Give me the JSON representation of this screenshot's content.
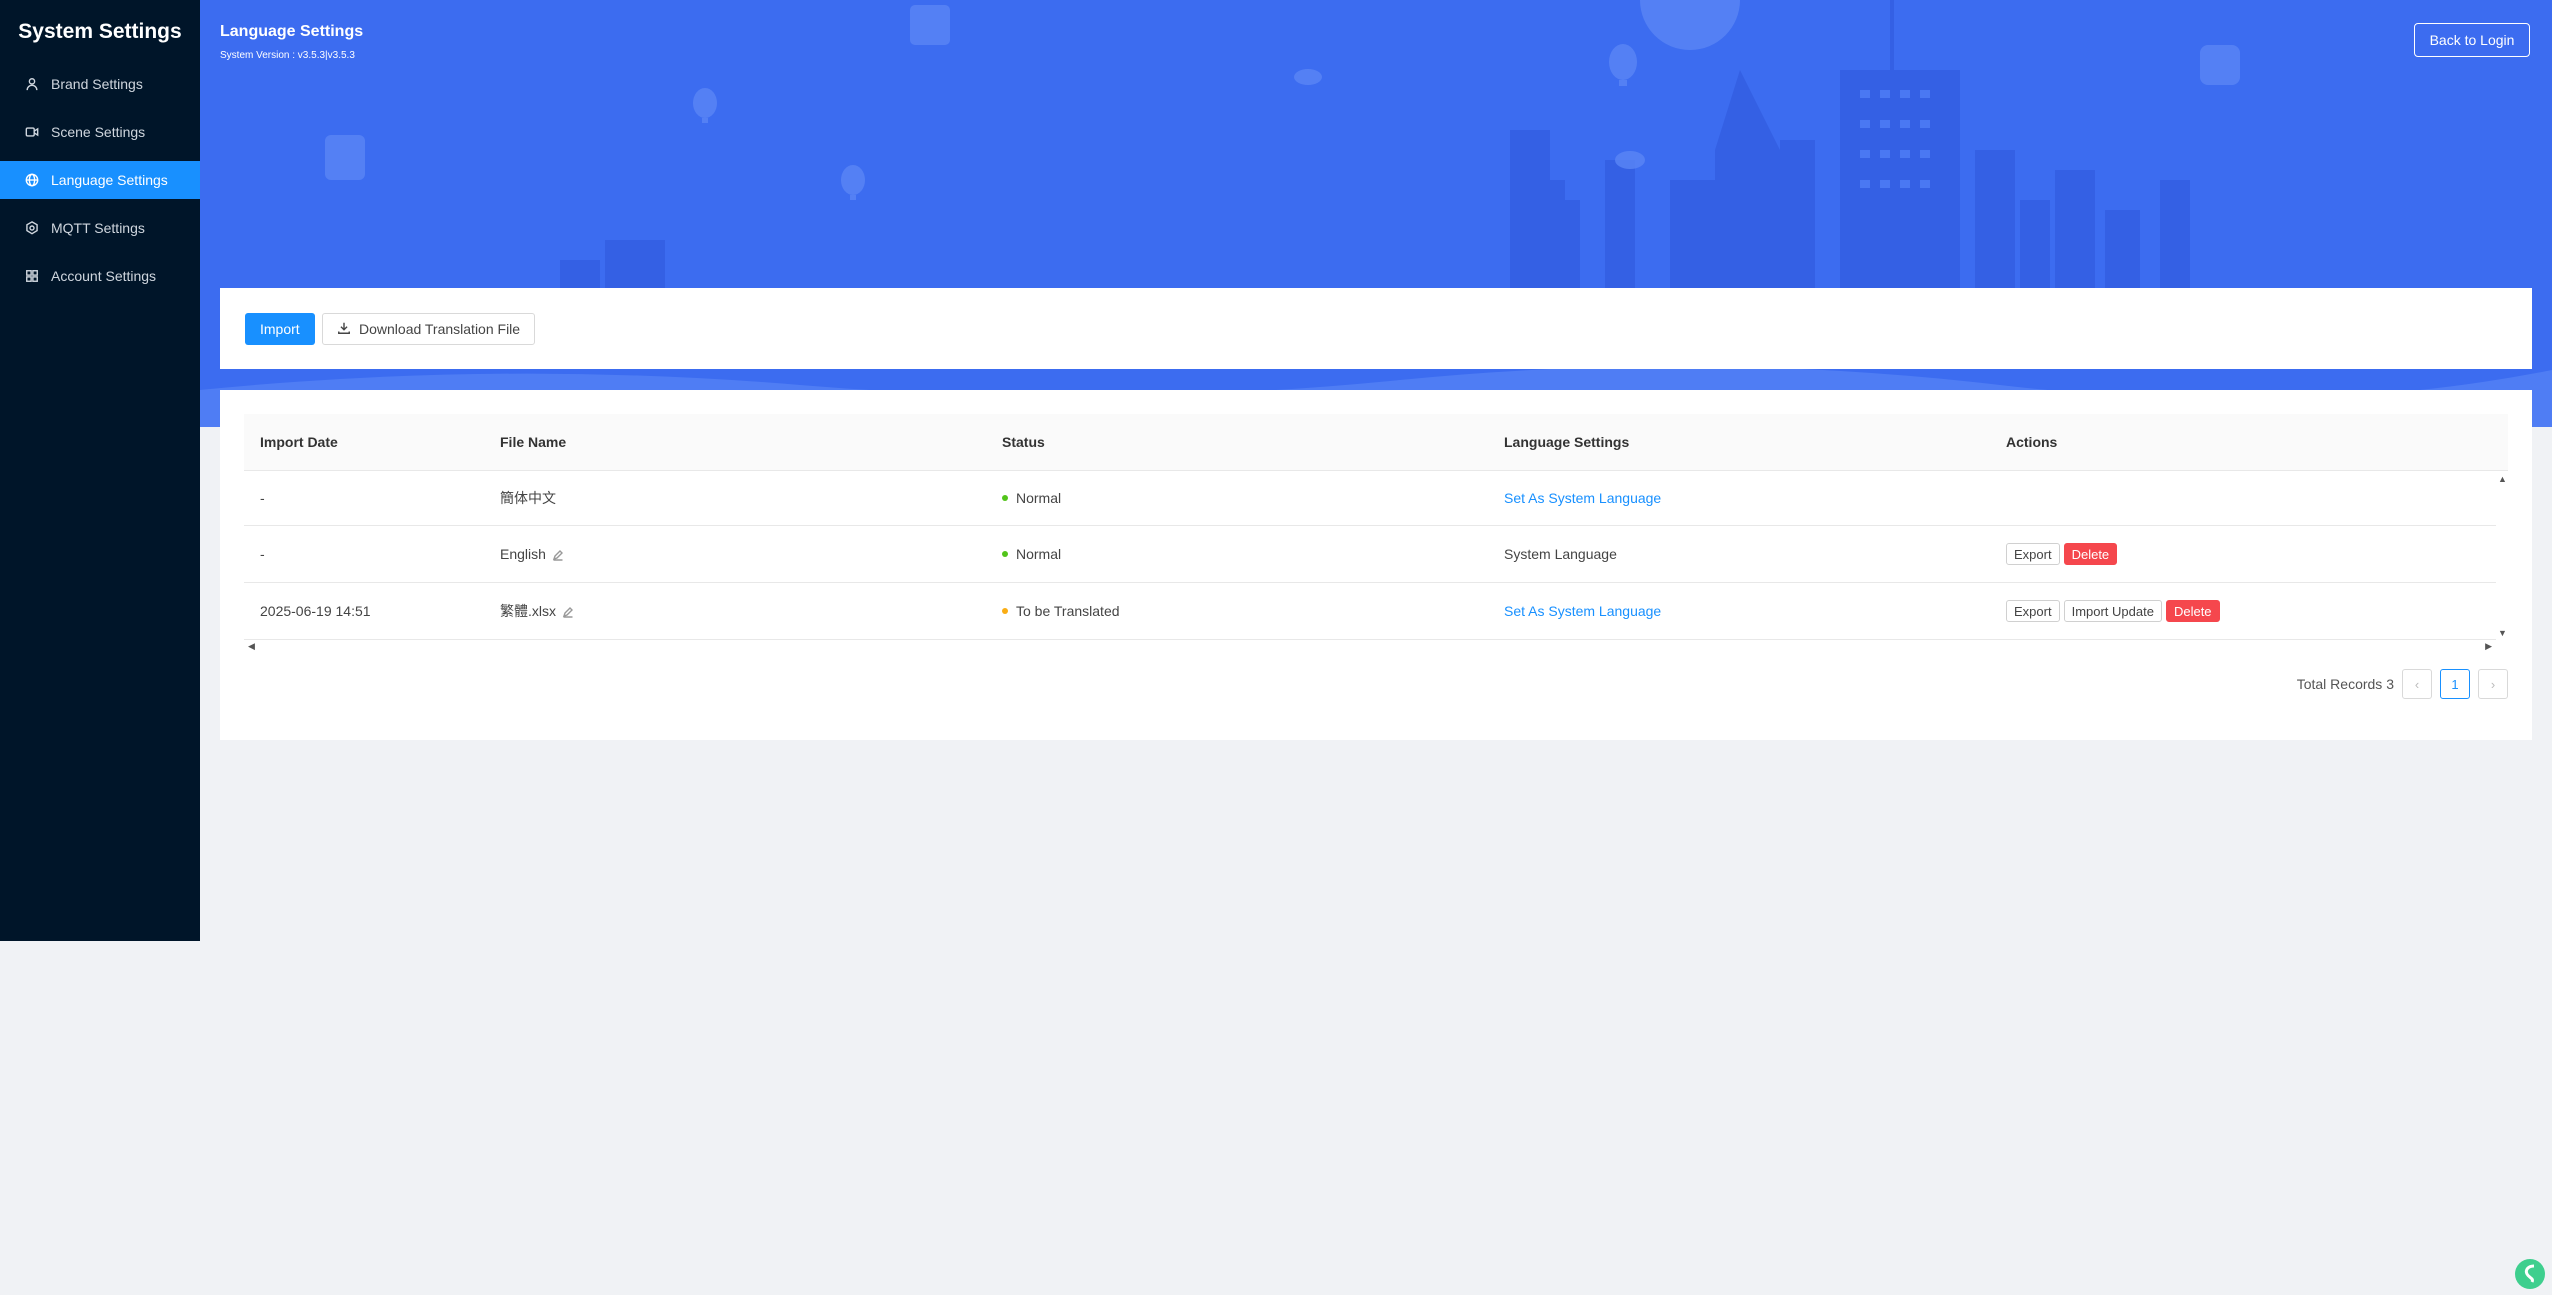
{
  "sidebar": {
    "title": "System Settings",
    "items": [
      {
        "label": "Brand Settings",
        "icon": "user-icon",
        "active": false
      },
      {
        "label": "Scene Settings",
        "icon": "video-icon",
        "active": false
      },
      {
        "label": "Language Settings",
        "icon": "globe-icon",
        "active": true
      },
      {
        "label": "MQTT Settings",
        "icon": "gear-icon",
        "active": false
      },
      {
        "label": "Account Settings",
        "icon": "grid-icon",
        "active": false
      }
    ]
  },
  "header": {
    "title": "Language Settings",
    "version": "System Version : v3.5.3|v3.5.3",
    "back_label": "Back to Login"
  },
  "toolbar": {
    "import_label": "Import",
    "download_label": "Download Translation File"
  },
  "table": {
    "columns": [
      "Import Date",
      "File Name",
      "Status",
      "Language Settings",
      "Actions"
    ],
    "rows": [
      {
        "date": "-",
        "file": "簡体中文",
        "editable": false,
        "status": "Normal",
        "status_color": "#52c41a",
        "language": "Set As System Language",
        "language_is_link": true,
        "actions": []
      },
      {
        "date": "-",
        "file": "English",
        "editable": true,
        "status": "Normal",
        "status_color": "#52c41a",
        "language": "System Language",
        "language_is_link": false,
        "actions": [
          "Export",
          "Delete"
        ]
      },
      {
        "date": "2025-06-19 14:51",
        "file": "繁體.xlsx",
        "editable": true,
        "status": "To be Translated",
        "status_color": "#faad14",
        "language": "Set As System Language",
        "language_is_link": true,
        "actions": [
          "Export",
          "Import Update",
          "Delete"
        ]
      }
    ]
  },
  "pagination": {
    "total_label": "Total Records 3",
    "current_page": "1",
    "prev_icon": "chevron-left-icon",
    "next_icon": "chevron-right-icon"
  },
  "colors": {
    "sidebar_bg": "#001529",
    "accent": "#1890ff",
    "banner": "#3c6cf0",
    "danger": "#f5474d"
  }
}
